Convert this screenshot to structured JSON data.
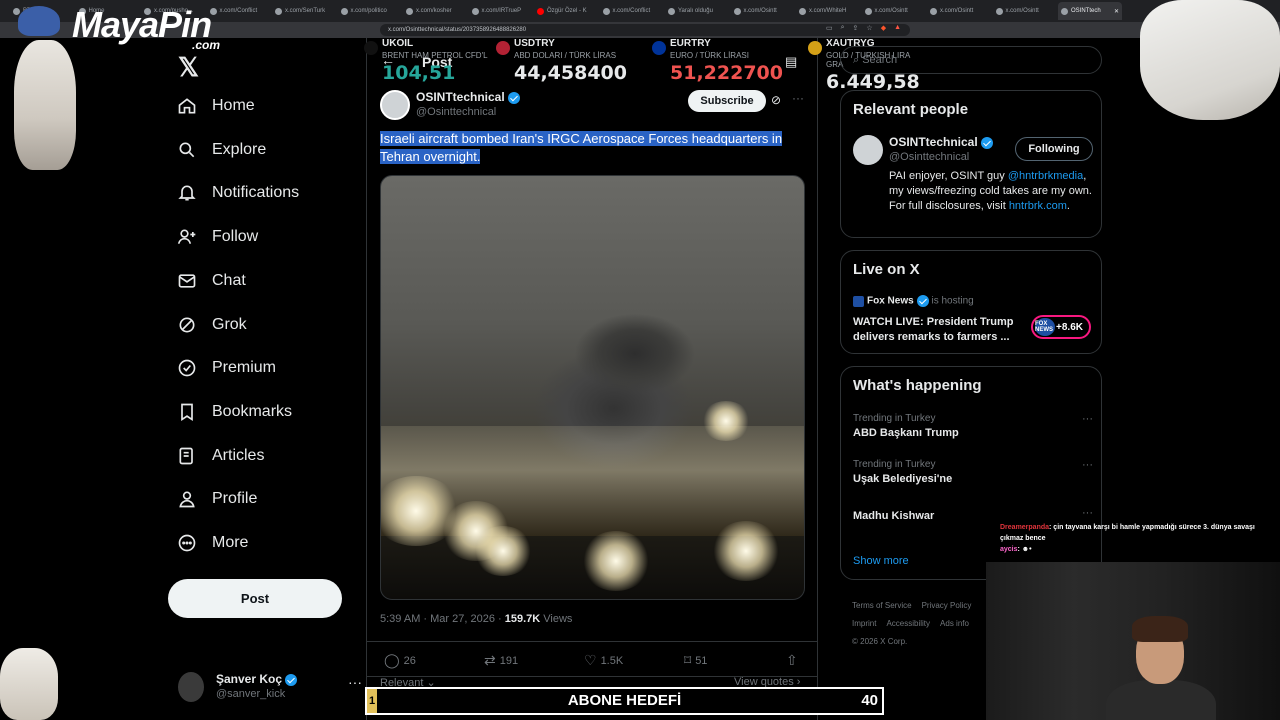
{
  "browser": {
    "tabs": [
      {
        "label": "BTC"
      },
      {
        "label": "Home"
      },
      {
        "label": "x.com/pusho..."
      },
      {
        "label": "x.com/Conflict"
      },
      {
        "label": "x.com/SenTurk"
      },
      {
        "label": "x.com/politico"
      },
      {
        "label": "x.com/kosher"
      },
      {
        "label": "x.com/IRTrueP"
      },
      {
        "label": "Özgür Özel - K"
      },
      {
        "label": "x.com/Conflict"
      },
      {
        "label": "Yaralı olduğu"
      },
      {
        "label": "x.com/Osintt"
      },
      {
        "label": "x.com/WhiteH"
      },
      {
        "label": "x.com/Osintt"
      },
      {
        "label": "x.com/Osintt"
      },
      {
        "label": "x.com/Osintt"
      },
      {
        "label": "OSINTtech"
      }
    ],
    "url": "x.com/Osinttechnical/status/2037358926488826280"
  },
  "overlay": {
    "logo_main": "MayaPin",
    "logo_sub": ".com",
    "goal_label": "ABONE HEDEFİ",
    "goal_current": "1",
    "goal_target": "40",
    "chat": [
      {
        "user": "Dreamerpanda",
        "text": ": çin tayvana karşı bi hamle yapmadığı sürece 3. dünya savaşı çıkmaz bence"
      },
      {
        "user": "aycis",
        "text": ": ☻•"
      }
    ]
  },
  "ticker": [
    {
      "symbol": "UKOIL",
      "sub": "BRENT HAM PETROL CFD'L",
      "value": "104,51",
      "color": "#26a69a"
    },
    {
      "symbol": "USDTRY",
      "sub": "ABD DOLARI / TÜRK LİRAS",
      "value": "44,458400",
      "color": "#e7e9ea"
    },
    {
      "symbol": "EURTRY",
      "sub": "EURO / TÜRK LİRASI",
      "value": "51,222700",
      "color": "#ef5350"
    },
    {
      "symbol": "XAUTRYG",
      "sub": "GOLD / TURKISH LIRA GRA",
      "value": "6.449,58",
      "color": "#e7e9ea"
    }
  ],
  "sidebar": {
    "items": [
      {
        "label": "Home",
        "icon": "home-icon"
      },
      {
        "label": "Explore",
        "icon": "search-icon"
      },
      {
        "label": "Notifications",
        "icon": "bell-icon"
      },
      {
        "label": "Follow",
        "icon": "person-add-icon"
      },
      {
        "label": "Chat",
        "icon": "mail-icon"
      },
      {
        "label": "Grok",
        "icon": "grok-icon"
      },
      {
        "label": "Premium",
        "icon": "premium-icon"
      },
      {
        "label": "Bookmarks",
        "icon": "bookmark-icon"
      },
      {
        "label": "Articles",
        "icon": "articles-icon"
      },
      {
        "label": "Profile",
        "icon": "person-icon"
      },
      {
        "label": "More",
        "icon": "more-circle-icon"
      }
    ],
    "post_label": "Post",
    "account": {
      "name": "Şanver Koç",
      "handle": "@sanver_kick"
    }
  },
  "post": {
    "header": "Post",
    "author_name": "OSINTtechnical",
    "author_handle": "@Osinttechnical",
    "subscribe_label": "Subscribe",
    "text": "Israeli aircraft bombed Iran's IRGC Aerospace Forces headquarters in Tehran overnight.",
    "time": "5:39 AM · Mar 27, 2026 · ",
    "views_count": "159.7K",
    "views_label": " Views",
    "replies": "26",
    "reposts": "191",
    "likes": "1.5K",
    "bookmarks": "51",
    "relevant_label": "Relevant",
    "view_quotes_label": "View quotes"
  },
  "right": {
    "search_placeholder": "Search",
    "relevant_people": {
      "title": "Relevant people",
      "name": "OSINTtechnical",
      "handle": "@Osinttechnical",
      "follow_label": "Following",
      "bio_1": "PAI enjoyer, OSINT guy ",
      "bio_mention": "@hntrbrkmedia",
      "bio_2": ", my views/freezing cold takes are my own. For full disclosures, visit ",
      "bio_link": "hntrbrk.com",
      "bio_3": "."
    },
    "live": {
      "title": "Live on X",
      "host": "Fox News",
      "host_suffix": " is hosting",
      "stream_title": "WATCH LIVE: President Trump delivers remarks to farmers ...",
      "viewers": "+8.6K",
      "badge_logo": "FOX NEWS"
    },
    "happening": {
      "title": "What's happening",
      "trends": [
        {
          "context": "Trending in Turkey",
          "topic": "ABD Başkanı Trump"
        },
        {
          "context": "Trending in Turkey",
          "topic": "Uşak Belediyesi'ne"
        },
        {
          "context": "",
          "topic": "Madhu Kishwar"
        }
      ],
      "show_more": "Show more"
    },
    "footer": [
      "Terms of Service",
      "Privacy Policy",
      "Imprint",
      "Accessibility",
      "Ads info",
      "© 2026 X Corp."
    ]
  }
}
